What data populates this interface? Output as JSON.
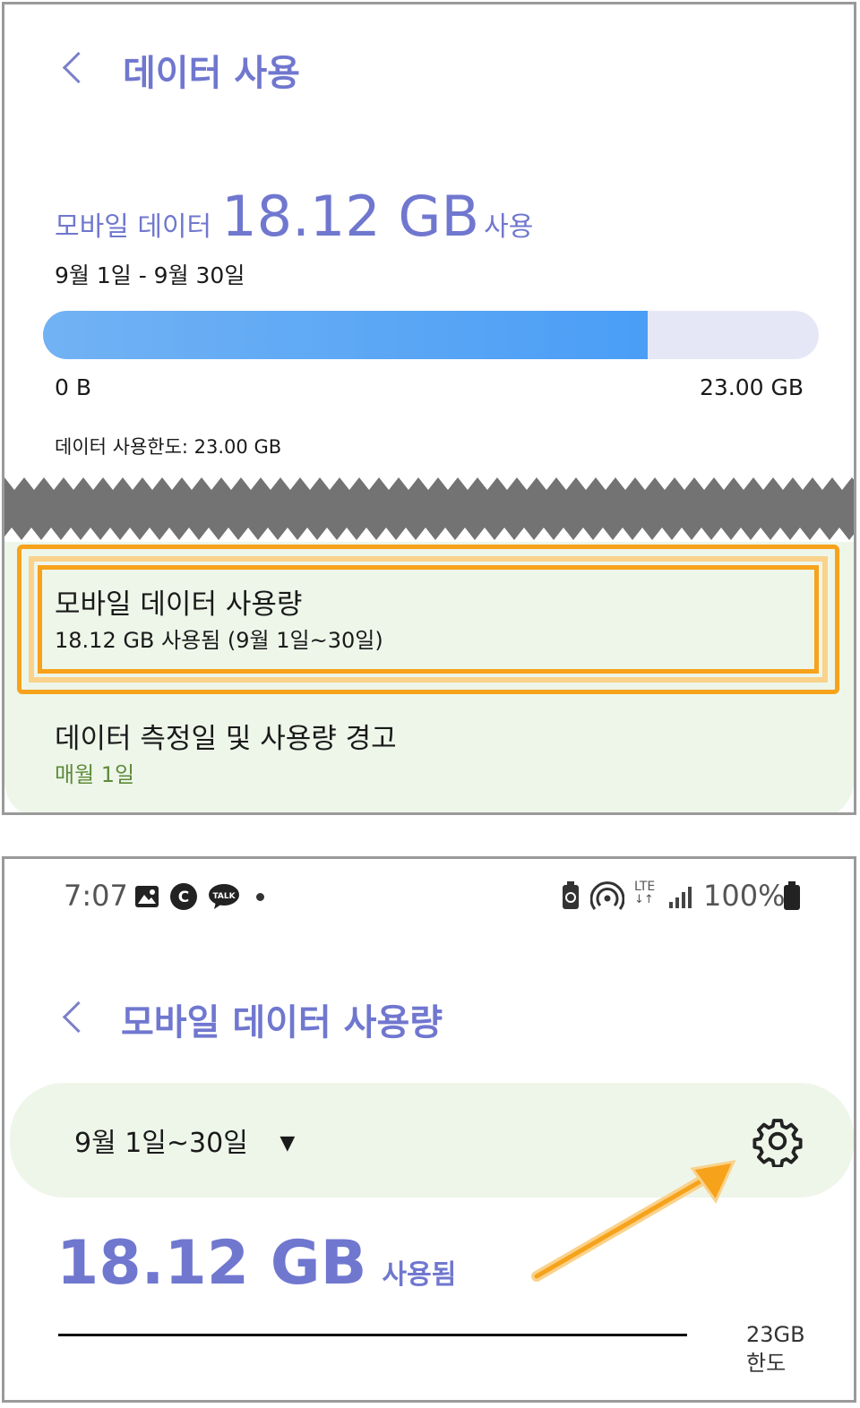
{
  "top": {
    "header": {
      "title": "데이터 사용"
    },
    "summary": {
      "prefix": "모바일 데이터",
      "amount": "18.12 GB",
      "suffix": "사용",
      "period": "9월 1일 - 9월 30일"
    },
    "usage_bar": {
      "min_label": "0 B",
      "max_label": "23.00 GB",
      "fill_fraction": 0.78
    },
    "limit_text": "데이터 사용한도: 23.00 GB",
    "list": [
      {
        "title": "모바일 데이터 사용량",
        "subtitle": "18.12 GB 사용됨 (9월 1일~30일)"
      },
      {
        "title": "데이터 측정일 및 사용량 경고",
        "subtitle": "매월 1일"
      }
    ]
  },
  "bottom": {
    "status_bar": {
      "time": "7:07",
      "battery": "100%",
      "network": "LTE"
    },
    "header": {
      "title": "모바일 데이터 사용량"
    },
    "period_selector": {
      "value": "9월 1일~30일"
    },
    "usage": {
      "amount": "18.12 GB",
      "suffix": "사용됨"
    },
    "limit": {
      "amount": "23GB",
      "label": "한도"
    }
  },
  "colors": {
    "accent": "#7077cf",
    "bar": "#4a9ef6",
    "highlight": "#f7a21b",
    "list_bg": "#eef6ea"
  },
  "icons": [
    "back-chevron-icon",
    "gallery-icon",
    "c-app-icon",
    "kakaotalk-icon",
    "battery-saver-icon",
    "hotspot-icon",
    "signal-icon",
    "battery-icon",
    "dropdown-triangle-icon",
    "gear-icon",
    "arrow-annotation"
  ]
}
